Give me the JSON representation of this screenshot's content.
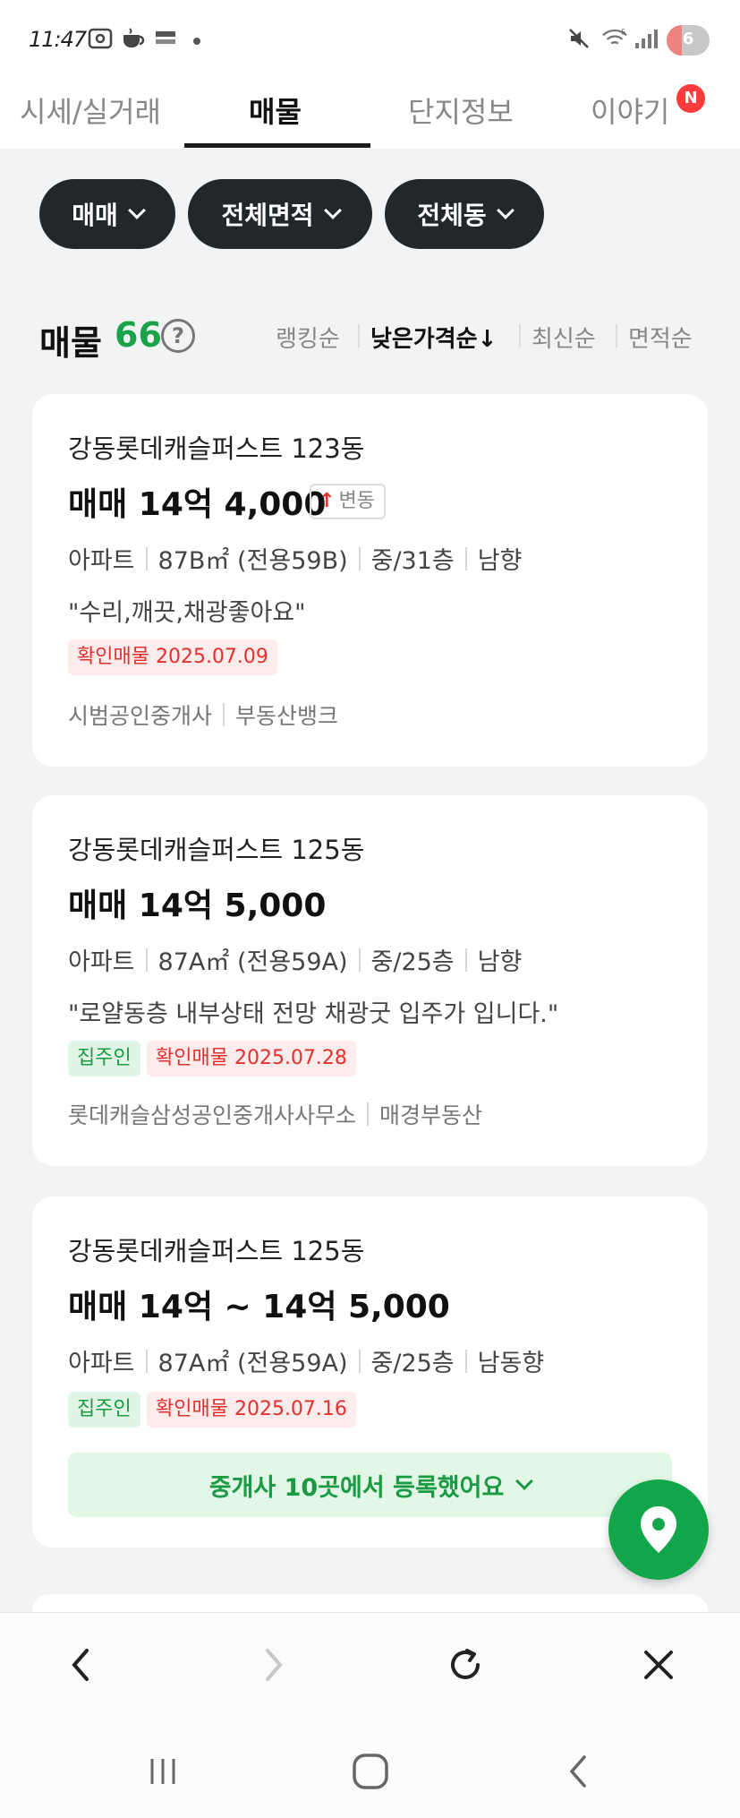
{
  "status_bar": {
    "time": "11:47",
    "battery_level": 6,
    "battery_fraction": 0.35,
    "icons": [
      "screenshot-icon",
      "coffee-icon",
      "app-notification-icon",
      "mute-icon",
      "wifi-icon",
      "signal-icon",
      "battery-icon"
    ]
  },
  "tabs": [
    {
      "label": "시세/실거래",
      "active": false
    },
    {
      "label": "매물",
      "active": true
    },
    {
      "label": "단지정보",
      "active": false
    },
    {
      "label": "이야기",
      "active": false,
      "badge": "N"
    }
  ],
  "filters": [
    {
      "label": "매매"
    },
    {
      "label": "전체면적"
    },
    {
      "label": "전체동"
    }
  ],
  "listing_header": {
    "title": "매물",
    "count": "66",
    "help": "?",
    "sorts": [
      {
        "label": "랭킹순",
        "active": false
      },
      {
        "label": "낮은가격순↓",
        "active": true
      },
      {
        "label": "최신순",
        "active": false
      },
      {
        "label": "면적순",
        "active": false
      }
    ]
  },
  "listings": [
    {
      "name": "강동롯데캐슬퍼스트 123동",
      "price": "매매 14억 4,000",
      "change_badge": "변동",
      "info": [
        "아파트",
        "87B㎡ (전용59B)",
        "중/31층",
        "남향"
      ],
      "description": "\"수리,깨끗,채광좋아요\"",
      "tags": [
        {
          "label": "확인매물 2025.07.09",
          "type": "red"
        }
      ],
      "agencies": [
        "시범공인중개사",
        "부동산뱅크"
      ]
    },
    {
      "name": "강동롯데캐슬퍼스트 125동",
      "price": "매매 14억 5,000",
      "info": [
        "아파트",
        "87A㎡ (전용59A)",
        "중/25층",
        "남향"
      ],
      "description": "\"로얄동층 내부상태 전망 채광굿 입주가 입니다.\"",
      "tags": [
        {
          "label": "집주인",
          "type": "green"
        },
        {
          "label": "확인매물 2025.07.28",
          "type": "red"
        }
      ],
      "agencies": [
        "롯데캐슬삼성공인중개사사무소",
        "매경부동산"
      ]
    },
    {
      "name": "강동롯데캐슬퍼스트 125동",
      "price": "매매 14억 ~ 14억 5,000",
      "info": [
        "아파트",
        "87A㎡ (전용59A)",
        "중/25층",
        "남동향"
      ],
      "tags": [
        {
          "label": "집주인",
          "type": "green"
        },
        {
          "label": "확인매물 2025.07.16",
          "type": "red"
        }
      ],
      "agency_button": "중개사 10곳에서 등록했어요"
    }
  ],
  "fab": {
    "icon": "map-pin-icon"
  },
  "browser_bar": {
    "icons": [
      "back-icon",
      "forward-icon",
      "refresh-icon",
      "close-icon"
    ]
  },
  "nav_bar": {
    "icons": [
      "recent-apps-icon",
      "home-icon",
      "nav-back-icon"
    ]
  },
  "colors": {
    "accent_green": "#1aa34a",
    "confirm_red": "#e03030",
    "chip_dark": "#22272c"
  }
}
